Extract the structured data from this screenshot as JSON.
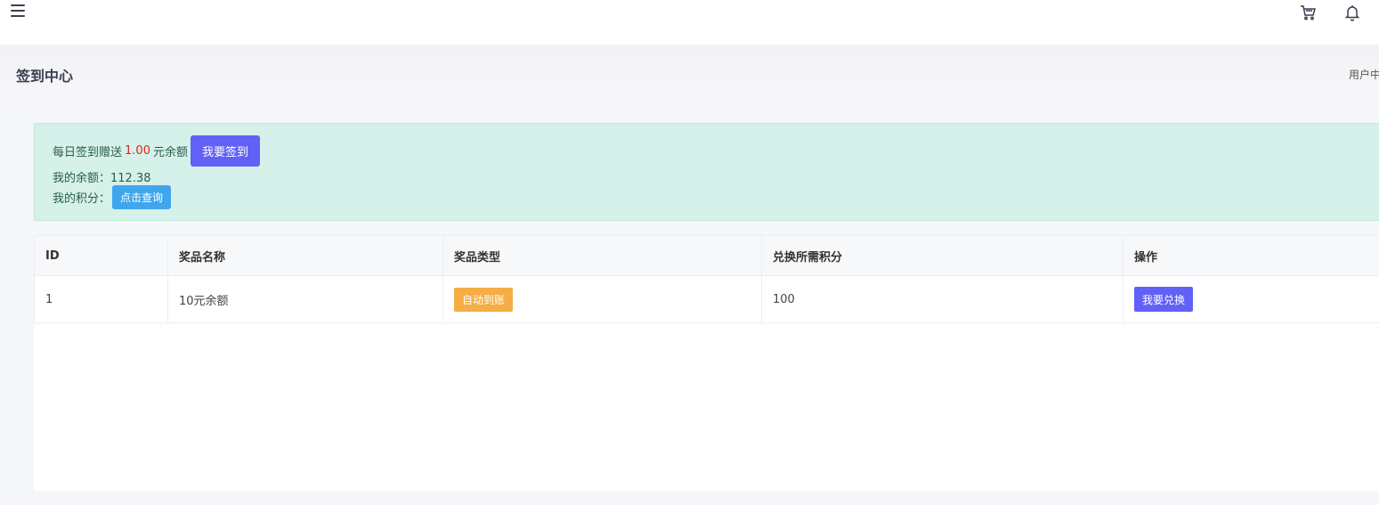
{
  "header": {
    "menu_icon": "hamburger-menu-icon",
    "cart_icon": "shopping-cart-icon",
    "bell_icon": "notification-bell-icon"
  },
  "page": {
    "title": "签到中心",
    "breadcrumb": "用户中"
  },
  "notice": {
    "daily_prefix": "每日签到赠送",
    "daily_amount": "1.00",
    "daily_suffix": "元余额",
    "checkin_button": "我要签到",
    "balance_label": "我的余额：",
    "balance_value": "112.38",
    "points_label": "我的积分：",
    "points_button": "点击查询"
  },
  "table": {
    "headers": [
      "ID",
      "奖品名称",
      "奖品类型",
      "兑换所需积分",
      "操作"
    ],
    "rows": [
      {
        "id": "1",
        "name": "10元余额",
        "type": "自动到账",
        "points": "100",
        "action": "我要兑换"
      }
    ]
  },
  "colors": {
    "primary": "#6261f5",
    "info": "#3fa6ee",
    "warning": "#f4ae43",
    "notice_bg": "#d5f1e9",
    "amount": "#e02222"
  }
}
